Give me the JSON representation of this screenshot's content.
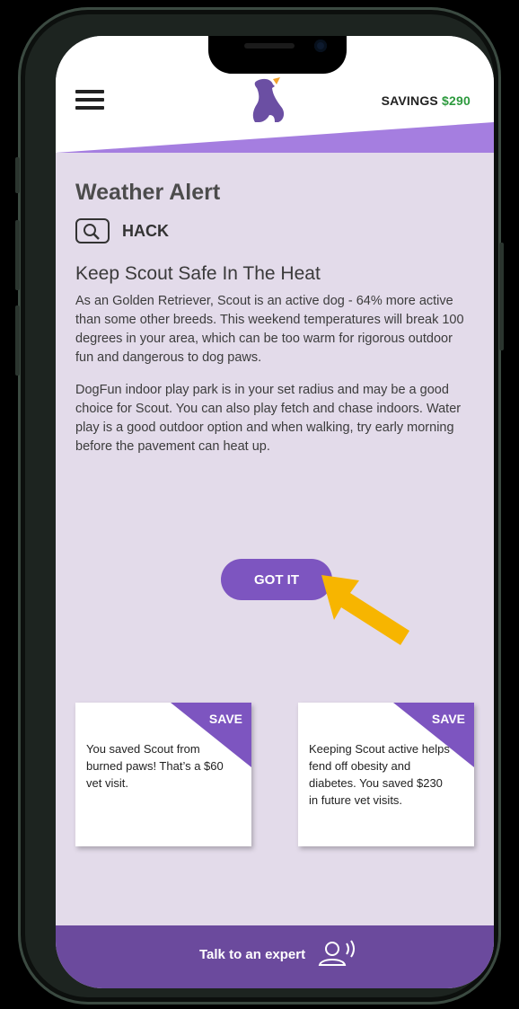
{
  "header": {
    "menu_icon": "hamburger-menu-icon",
    "logo_icon": "dog-logo-icon",
    "savings_label": "SAVINGS",
    "savings_amount": "$290",
    "accent_color": "#a57ee0"
  },
  "alert": {
    "title": "Weather Alert",
    "tag_icon": "magnifier-icon",
    "tag_label": "HACK",
    "subtitle": "Keep Scout Safe In The Heat",
    "paragraphs": [
      "As an Golden Retriever, Scout is an active dog - 64% more active than some other breeds. This weekend temperatures will break 100 degrees in your area, which can be too warm for rigorous outdoor fun and dangerous to dog paws.",
      "DogFun indoor play park is in your set radius and may be a good choice for Scout. You can also play fetch and chase indoors. Water play is a good outdoor option and when walking, try early morning before the pavement can heat up."
    ],
    "button_label": "GOT IT",
    "button_color": "#7d55c0",
    "pointer_icon": "arrow-pointer-icon",
    "pointer_color": "#f7b500"
  },
  "cards": [
    {
      "badge": "SAVE",
      "text": "You saved Scout from burned paws! That’s a $60 vet visit."
    },
    {
      "badge": "SAVE",
      "text": "Keeping Scout active helps fend off obesity and diabetes. You saved $230 in future vet visits."
    }
  ],
  "footer": {
    "label": "Talk to an expert",
    "icon": "expert-voice-icon",
    "background": "#6b4a9d"
  }
}
